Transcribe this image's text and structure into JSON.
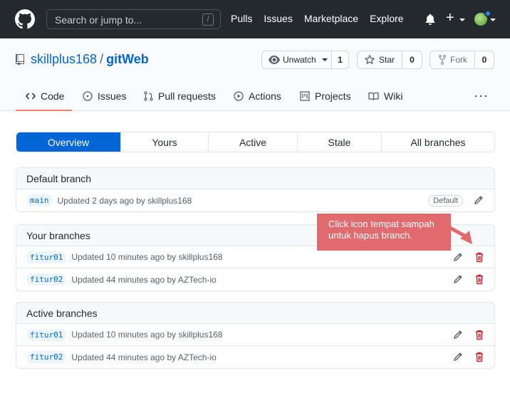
{
  "header": {
    "search_placeholder": "Search or jump to...",
    "search_shortcut": "/",
    "nav": [
      "Pulls",
      "Issues",
      "Marketplace",
      "Explore"
    ],
    "plus": "+"
  },
  "repo": {
    "owner": "skillplus168",
    "separator": "/",
    "name": "gitWeb",
    "watch_label": "Unwatch",
    "watch_count": "1",
    "star_label": "Star",
    "star_count": "0",
    "fork_label": "Fork",
    "fork_count": "0"
  },
  "tabs": [
    "Code",
    "Issues",
    "Pull requests",
    "Actions",
    "Projects",
    "Wiki"
  ],
  "more": "···",
  "filters": {
    "items": [
      "Overview",
      "Yours",
      "Active",
      "Stale",
      "All branches"
    ],
    "selected": "Overview"
  },
  "default_branch": {
    "title": "Default branch",
    "rows": [
      {
        "name": "main",
        "status": "Updated 2 days ago by skillplus168",
        "badge": "Default"
      }
    ]
  },
  "your_branches": {
    "title": "Your branches",
    "rows": [
      {
        "name": "fitur01",
        "status": "Updated 10 minutes ago by skillplus168"
      },
      {
        "name": "fitur02",
        "status": "Updated 44 minutes ago by AZTech-io"
      }
    ]
  },
  "active_branches": {
    "title": "Active branches",
    "rows": [
      {
        "name": "fitur01",
        "status": "Updated 10 minutes ago by skillplus168"
      },
      {
        "name": "fitur02",
        "status": "Updated 44 minutes ago by AZTech-io"
      }
    ]
  },
  "callout": {
    "text": "Click icon tempat sampah untuk hapus branch."
  },
  "colors": {
    "topbar": "#24292e",
    "accent": "#0366d6",
    "danger": "#cb2431",
    "callout": "#e06a6d",
    "tab_underline": "#f9826c"
  }
}
